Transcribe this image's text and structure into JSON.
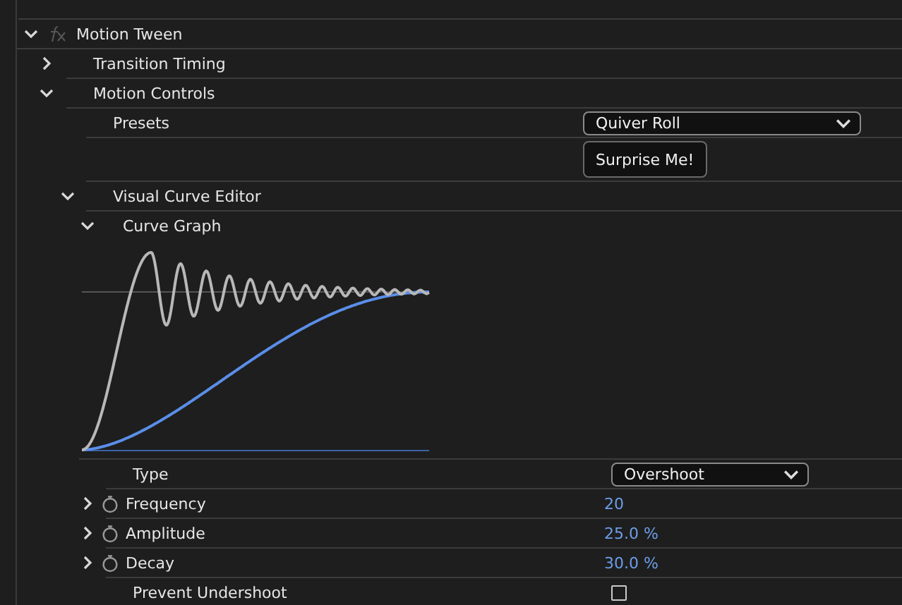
{
  "effect": {
    "label": "Motion Tween",
    "expanded": true,
    "sections": [
      {
        "label": "Transition Timing",
        "expanded": false
      },
      {
        "label": "Motion Controls",
        "expanded": true,
        "presets": {
          "label": "Presets",
          "value": "Quiver Roll"
        },
        "surprise_button": "Surprise Me!",
        "curve_editor": {
          "label": "Visual Curve Editor",
          "expanded": true,
          "curve_graph": {
            "label": "Curve Graph",
            "expanded": true
          },
          "type": {
            "label": "Type",
            "value": "Overshoot"
          },
          "params": [
            {
              "label": "Frequency",
              "expanded": false,
              "value": "20"
            },
            {
              "label": "Amplitude",
              "expanded": false,
              "value": "25.0 %"
            },
            {
              "label": "Decay",
              "expanded": false,
              "value": "30.0 %"
            }
          ],
          "prevent_undershoot": {
            "label": "Prevent Undershoot",
            "checked": false
          }
        }
      }
    ]
  }
}
